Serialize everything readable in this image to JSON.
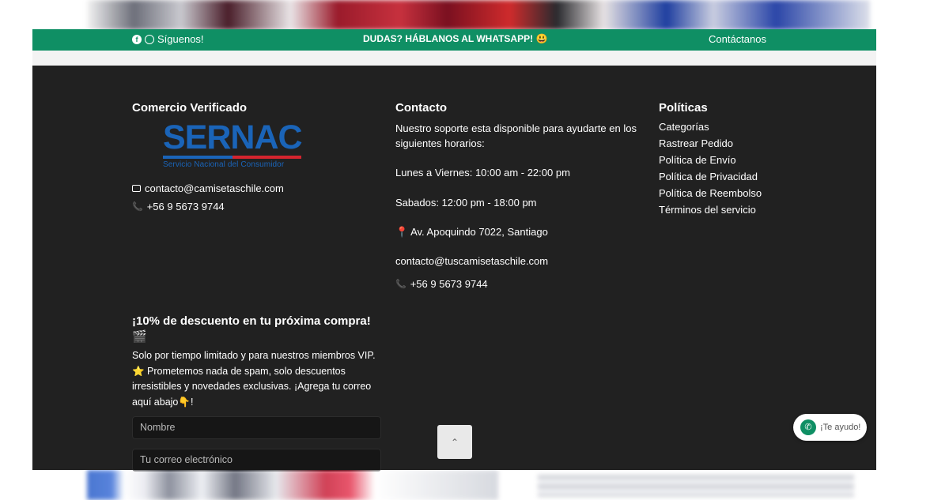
{
  "topbar": {
    "follow_label": "Síguenos!",
    "whatsapp_cta": "DUDAS? HÁBLANOS AL WHATSAPP! 😃",
    "contact_link": "Contáctanos"
  },
  "footer": {
    "verified": {
      "title": "Comercio Verificado",
      "logo_word": "SERNAC",
      "logo_sub": "Servicio Nacional del Consumidor",
      "email": "contacto@camisetaschile.com",
      "phone": "+56 9 5673 9744"
    },
    "contact": {
      "title": "Contacto",
      "intro": "Nuestro soporte esta disponible para ayudarte en los siguientes horarios:",
      "weekdays": "Lunes a Viernes: 10:00 am - 22:00 pm",
      "saturday": "Sabados: 12:00 pm - 18:00 pm",
      "address": "📍 Av. Apoquindo 7022, Santiago",
      "email": "contacto@tuscamisetaschile.com",
      "phone": "+56 9 5673 9744"
    },
    "policies": {
      "title": "Políticas",
      "links": [
        "Categorías",
        "Rastrear Pedido",
        "Política de Envío",
        "Política de Privacidad",
        "Política de Reembolso",
        "Términos del servicio"
      ]
    },
    "promo": {
      "title": "¡10% de descuento en tu próxima compra! 🎬",
      "text": "Solo por tiempo limitado y para nuestros miembros VIP. ⭐ Prometemos nada de spam, solo descuentos irresistibles y novedades exclusivas. ¡Agrega tu correo aquí abajo👇!",
      "name_placeholder": "Nombre",
      "email_placeholder": "Tu correo electrónico"
    }
  },
  "back_to_top": "⌃",
  "whatsapp_widget": {
    "label": "¡Te ayudo!"
  },
  "colors": {
    "brand_green": "#0f8f64",
    "footer_bg": "#212121",
    "sernac_blue": "#1a64b8"
  }
}
